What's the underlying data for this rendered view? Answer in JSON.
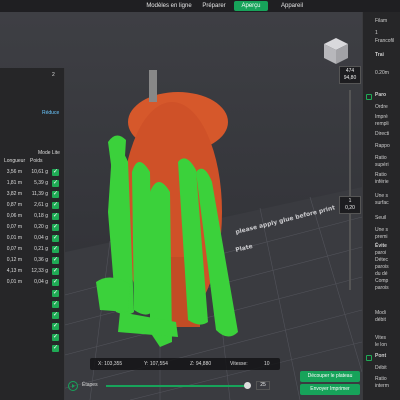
{
  "menu": {
    "tabs": [
      {
        "label": "Modèles en ligne"
      },
      {
        "label": "Préparer"
      },
      {
        "label": "Aperçu"
      },
      {
        "label": "Appareil"
      }
    ],
    "active_tab": "Aperçu"
  },
  "left_panel": {
    "count": "2",
    "reduce_label": "Réduce",
    "mode_label": "Mode Lite",
    "columns": {
      "length": "Longueur",
      "weight": "Poids"
    },
    "rows": [
      {
        "length": "3,56 m",
        "weight": "10,61 g"
      },
      {
        "length": "1,81 m",
        "weight": "5,39 g"
      },
      {
        "length": "3,82 m",
        "weight": "11,39 g"
      },
      {
        "length": "0,87 m",
        "weight": "2,61 g"
      },
      {
        "length": "0,06 m",
        "weight": "0,18 g"
      },
      {
        "length": "0,07 m",
        "weight": "0,20 g"
      },
      {
        "length": "0,01 m",
        "weight": "0,04 g"
      },
      {
        "length": "0,07 m",
        "weight": "0,21 g"
      },
      {
        "length": "0,12 m",
        "weight": "0,36 g"
      },
      {
        "length": "4,13 m",
        "weight": "12,33 g"
      },
      {
        "length": "0,01 m",
        "weight": "0,04 g"
      }
    ]
  },
  "slider": {
    "top_value": "474",
    "top_height": "94,80",
    "bottom_value": "1",
    "bottom_height": "0,20"
  },
  "plate_text": "please apply glue before print",
  "plate_text2": "Plate",
  "coords": {
    "x": "X: 103,355",
    "y": "Y: 107,554",
    "z": "Z: 94,880",
    "speed_label": "Vitesse:",
    "speed_value": "10"
  },
  "steps": {
    "label": "Étapes",
    "value": "25"
  },
  "buttons": {
    "cut_plate": "Découper le plateau",
    "send_print": "Envoyer Imprimer"
  },
  "right_panel": {
    "items": [
      "Filam",
      "1",
      "Francofil",
      "Trai",
      "0.20m",
      "Paro",
      "Ordre",
      "Impré",
      "rempli",
      "Directi",
      "Rappo",
      "Ratio",
      "supéri",
      "Ratio",
      "inférie",
      "Une s",
      "surfac",
      "Seuil",
      "Une s",
      "premi",
      "Évite",
      "paroi",
      "Détec",
      "parois",
      "du dé",
      "Comp",
      "parois",
      "Modi",
      "débit",
      "Vites",
      "le lon",
      "Pont",
      "Débit",
      "Ratio",
      "interm"
    ]
  },
  "colors": {
    "accent": "#17a35a",
    "support": "#3ad23a",
    "model": "#d8562a"
  }
}
